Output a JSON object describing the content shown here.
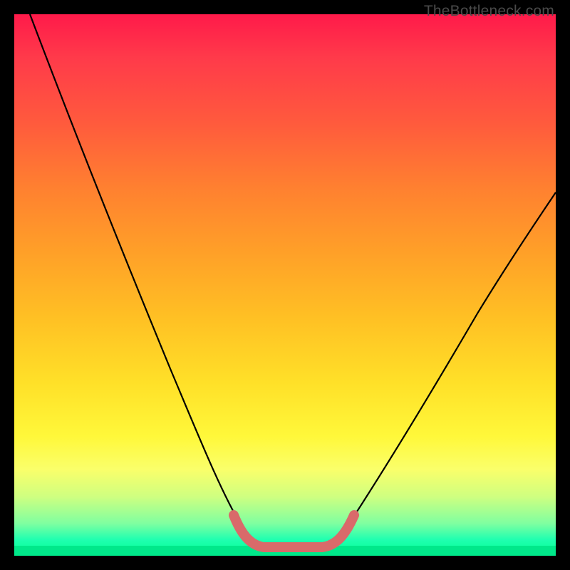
{
  "watermark": "TheBottleneck.com",
  "chart_data": {
    "type": "line",
    "title": "",
    "xlabel": "",
    "ylabel": "",
    "xlim": [
      0,
      100
    ],
    "ylim": [
      0,
      100
    ],
    "series": [
      {
        "name": "bottleneck-curve",
        "x": [
          3,
          10,
          18,
          25,
          32,
          37,
          40,
          43,
          46,
          50,
          54,
          57,
          60,
          65,
          72,
          80,
          88,
          95,
          100
        ],
        "y": [
          100,
          84,
          68,
          54,
          40,
          28,
          18,
          10,
          4,
          2,
          2,
          4,
          8,
          16,
          27,
          38,
          48,
          56,
          62
        ]
      }
    ],
    "highlight_segment": {
      "name": "optimal-range",
      "x": [
        42,
        58
      ],
      "y": [
        3,
        3
      ],
      "color": "#d96a6a"
    },
    "background_gradient": {
      "stops": [
        {
          "pos": 0.0,
          "color": "#ff1a4a"
        },
        {
          "pos": 0.2,
          "color": "#ff5a3d"
        },
        {
          "pos": 0.44,
          "color": "#ffa028"
        },
        {
          "pos": 0.68,
          "color": "#ffe028"
        },
        {
          "pos": 0.84,
          "color": "#faff6a"
        },
        {
          "pos": 0.94,
          "color": "#80ffa0"
        },
        {
          "pos": 1.0,
          "color": "#00ff90"
        }
      ]
    },
    "colors": {
      "curve": "#000000",
      "highlight": "#d96a6a",
      "frame": "#000000"
    }
  }
}
